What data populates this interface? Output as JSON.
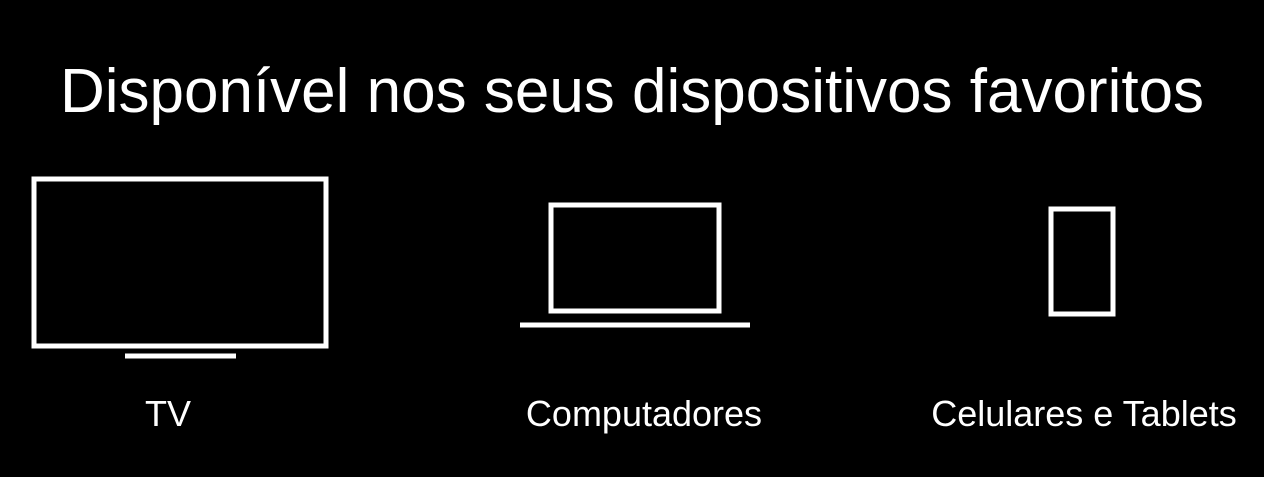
{
  "headline": "Disponível nos seus dispositivos favoritos",
  "devices": [
    {
      "label": "TV",
      "icon": "tv-icon"
    },
    {
      "label": "Computadores",
      "icon": "laptop-icon"
    },
    {
      "label": "Celulares e Tablets",
      "icon": "phone-tablet-icon"
    }
  ],
  "colors": {
    "background": "#000000",
    "foreground": "#ffffff"
  }
}
